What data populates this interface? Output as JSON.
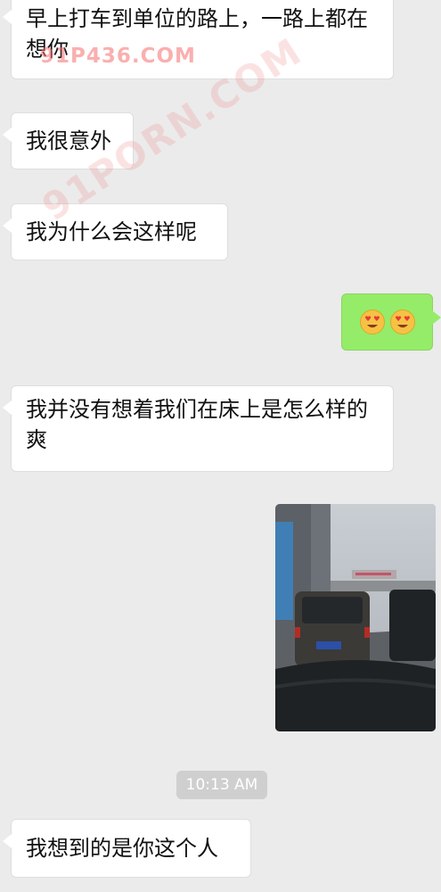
{
  "messages": [
    {
      "side": "in",
      "text": "早上打车到单位的路上，一路上都在想你"
    },
    {
      "side": "in",
      "text": "我很意外"
    },
    {
      "side": "in",
      "text": "我为什么会这样呢"
    },
    {
      "side": "out",
      "emojis": [
        "heart-eyes-emoji",
        "heart-eyes-emoji"
      ]
    },
    {
      "side": "in",
      "text": "我并没有想着我们在床上是怎么样的爽"
    },
    {
      "side": "out",
      "media": "video-thumbnail"
    },
    {
      "side": "in",
      "text": "我想到的是你这个人"
    }
  ],
  "timestamp": "10:13 AM",
  "watermarks": {
    "top": "91P436.COM",
    "diagonal": "91PORN.COM"
  },
  "colors": {
    "background": "#ebebeb",
    "incoming_bubble": "#ffffff",
    "outgoing_bubble": "#95ec69",
    "timestamp_bg": "#cfcfcf"
  }
}
